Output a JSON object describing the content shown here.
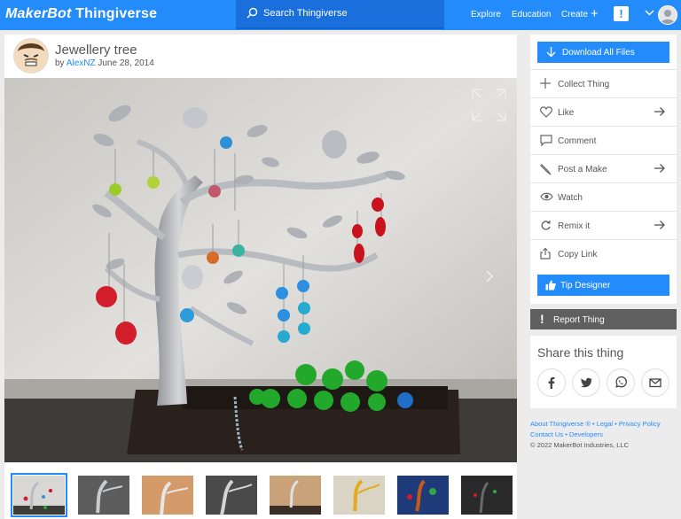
{
  "header": {
    "brand_makerbot": "MakerBot",
    "brand_thingiverse": "Thingiverse",
    "search_placeholder": "Search Thingiverse",
    "nav": {
      "explore": "Explore",
      "education": "Education",
      "create": "Create"
    },
    "notification": "!"
  },
  "thing": {
    "title": "Jewellery tree",
    "by": "by",
    "author": "AlexNZ",
    "date": "June 28, 2014"
  },
  "thumbnails": [
    {
      "name": "thumb-1",
      "selected": true
    },
    {
      "name": "thumb-2"
    },
    {
      "name": "thumb-3"
    },
    {
      "name": "thumb-4"
    },
    {
      "name": "thumb-5"
    },
    {
      "name": "thumb-6"
    },
    {
      "name": "thumb-7"
    },
    {
      "name": "thumb-8"
    }
  ],
  "sidebar": {
    "download": "Download All Files",
    "actions": [
      {
        "label": "Collect Thing",
        "icon": "plus-icon",
        "arrow": false
      },
      {
        "label": "Like",
        "icon": "heart-icon",
        "arrow": true
      },
      {
        "label": "Comment",
        "icon": "comment-icon",
        "arrow": false
      },
      {
        "label": "Post a Make",
        "icon": "make-icon",
        "arrow": true
      },
      {
        "label": "Watch",
        "icon": "eye-icon",
        "arrow": false
      },
      {
        "label": "Remix it",
        "icon": "remix-icon",
        "arrow": true
      },
      {
        "label": "Copy Link",
        "icon": "share-icon",
        "arrow": false
      }
    ],
    "tip": "Tip Designer",
    "report": "Report Thing",
    "share_title": "Share this thing"
  },
  "footer": {
    "about": "About Thingiverse ®",
    "legal": "Legal",
    "privacy": "Privacy Policy",
    "contact": "Contact Us",
    "developers": "Developers",
    "copyright": "©  2022 MakerBot Industries, LLC"
  },
  "colors": {
    "accent": "#248bfb",
    "dark": "#5f5f5f"
  }
}
